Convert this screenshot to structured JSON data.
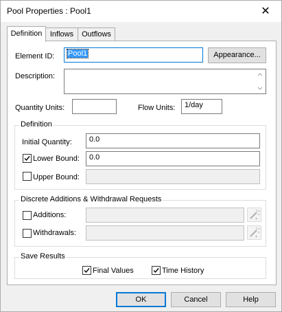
{
  "window": {
    "title": "Pool Properties : Pool1",
    "close_glyph": "✕"
  },
  "tabs": [
    {
      "label": "Definition",
      "active": true
    },
    {
      "label": "Inflows",
      "active": false
    },
    {
      "label": "Outflows",
      "active": false
    }
  ],
  "element_id": {
    "label": "Element ID:",
    "value": "Pool1"
  },
  "appearance_button": "Appearance...",
  "description": {
    "label": "Description:",
    "value": ""
  },
  "quantity_units": {
    "label": "Quantity Units:",
    "value": ""
  },
  "flow_units": {
    "label": "Flow Units:",
    "value": "1/day"
  },
  "definition_group": {
    "title": "Definition",
    "initial_quantity": {
      "label": "Initial Quantity:",
      "value": "0.0"
    },
    "lower_bound": {
      "label": "Lower Bound:",
      "checked": true,
      "value": "0.0"
    },
    "upper_bound": {
      "label": "Upper Bound:",
      "checked": false,
      "value": ""
    }
  },
  "discrete_group": {
    "title": "Discrete Additions & Withdrawal Requests",
    "additions": {
      "label": "Additions:",
      "checked": false,
      "value": ""
    },
    "withdrawals": {
      "label": "Withdrawals:",
      "checked": false,
      "value": ""
    }
  },
  "save_results": {
    "title": "Save Results",
    "final_values": {
      "label": "Final Values",
      "checked": true
    },
    "time_history": {
      "label": "Time History",
      "checked": true
    }
  },
  "buttons": {
    "ok": "OK",
    "cancel": "Cancel",
    "help": "Help"
  },
  "icons": {
    "wizard": "magic-wand-icon",
    "check": "checkmark-icon"
  }
}
